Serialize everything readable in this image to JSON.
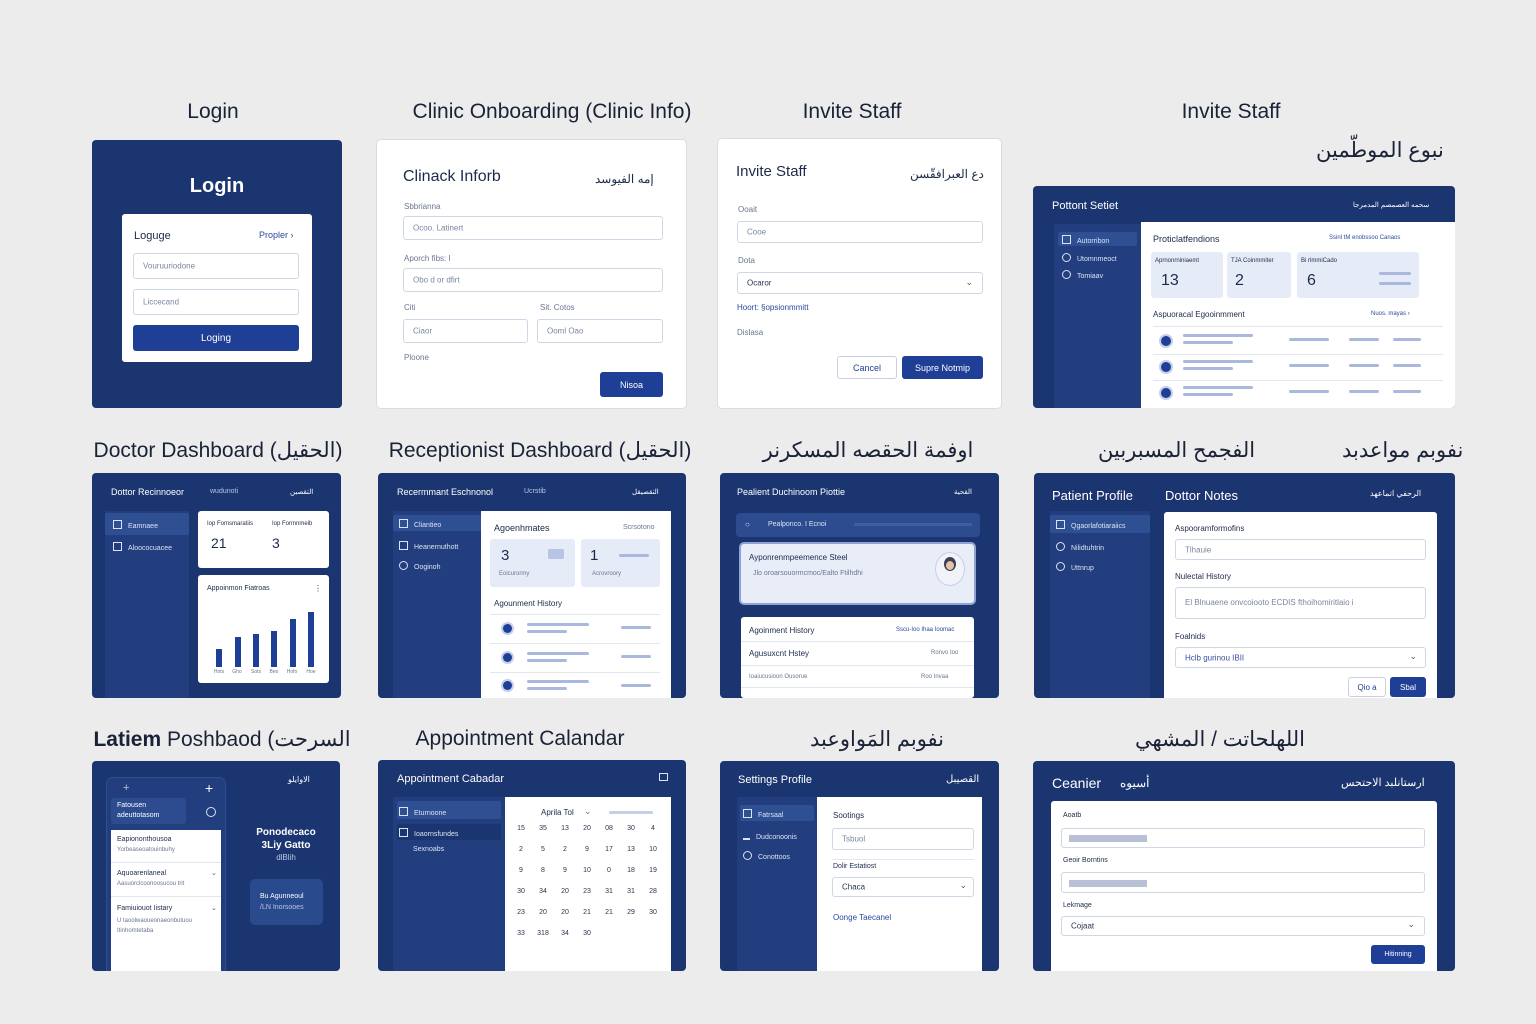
{
  "titles": {
    "login": "Login",
    "clinic": "Clinic Onboarding (Clinic Info)",
    "invite1": "Invite Staff",
    "invite2": "Invite Staff",
    "invite2_ar": "نبوع الموطّمين",
    "doctor": "Doctor Dashboard (الحقيل)",
    "reception": "Receptionist Dashboard (الحقيل)",
    "ar_mid": "اوفمة الحقصه المسكرنر",
    "ar_right1": "الفجمح المسبربين",
    "ar_right2": "نفوبم مواعدبد",
    "latiem_bold": "Latiem",
    "latiem_rest": " Poshbaod (السرحت",
    "calendar": "Appointment Calandar",
    "ar_settings": "نفوبم المَواوعبد",
    "ar_last": "اللهلحاتت / المشهي"
  },
  "login": {
    "heading": "Login",
    "form_title": "Loguge",
    "link": "Propler",
    "field1": "Vouruuriodone",
    "field2": "Liccecand",
    "button": "Loging"
  },
  "clinic": {
    "title": "Clinack Inforb",
    "title_ar": "إمه الفيوسد",
    "label1": "Sbbrianna",
    "ph1": "Ocoo. Latinert",
    "label2": "Aporch fibs: I",
    "ph2": "Obo d or dfirt",
    "label3": "Citi",
    "label4": "Sit. Cotos",
    "ph3": "Ciaor",
    "ph4": "Ooml Oao",
    "label5": "Ploone",
    "button": "Nisoa"
  },
  "invite1": {
    "title": "Invite Staff",
    "title_ar": "دع العبرافقّسن",
    "label1": "Ooait",
    "ph1": "Cooe",
    "label2": "Dota",
    "select": "Ocaror",
    "hint": "Hoort: §opsionmmitt",
    "hint2": "Dislasa",
    "cancel": "Cancel",
    "submit": "Supre Notmip"
  },
  "invite2": {
    "app": "Pottont Setiet",
    "top_ar": "سحمه العصمصم المدمرجا",
    "side": [
      "Autorribon",
      "Utomnmeoct",
      "Tomiaav"
    ],
    "section": "Proticlatfendions",
    "section_link": "Ssinl tM enobssoo Canaos",
    "stats": [
      {
        "label": "Aprnonrniniaemt",
        "value": "13"
      },
      {
        "label": "TJA Coinmmiter",
        "value": "2"
      },
      {
        "label": "Bi rlmmiCado",
        "value": "6"
      }
    ],
    "list_title": "Aspuoracal Egooinmment",
    "list_link": "Nuos. mayas"
  },
  "doctor": {
    "app": "Dottor Recinnoeor",
    "app2": "wudunoti",
    "app_ar": "التقصبن",
    "side": [
      "Eamnaee",
      "Aloococuacee"
    ],
    "stat1_label": "Iop Fomsmaratiis",
    "stat1": "21",
    "stat2_label": "Iop Formnmeib",
    "stat2": "3",
    "chart_title": "Appoinmon Fiatroas",
    "chart_more": "⋮"
  },
  "chart_data": {
    "type": "bar",
    "values": [
      3,
      5,
      5.5,
      6,
      8,
      9.2
    ],
    "categories": [
      "Hots",
      "Gho",
      "Sots",
      "Beo",
      "Hofo",
      "Hoe"
    ],
    "ylim": [
      0,
      10
    ]
  },
  "reception": {
    "app": "Recermmant Eschnonol",
    "app2": "Ucrstib",
    "app_ar": "التقصيقل",
    "side": [
      "Cliantieo",
      "Heanernuthott",
      "Ooginoh"
    ],
    "section": "Agoenhmates",
    "section_link": "Scrsotono",
    "stat1": "3",
    "stat1_label": "Eoicurormy",
    "stat2": "1",
    "stat2_label": "Acrovroory",
    "history": "Agounment History"
  },
  "patient_detail": {
    "app": "Pealient Duchinoom Piottie",
    "app_ar": "القحية",
    "search": "Pealponco. I Ecnoi",
    "card_title": "Ayponrenmpeemence Steel",
    "card_text": "Jlo oroarsouormcmoc/Ealto Ftilhdhi",
    "hist_title": "Agoinment History",
    "hist_link": "Sscu-Ioo Ihaa Ioomac",
    "row1": "Agusuxcnt Hstey",
    "row1r": "Ronvo Ioo",
    "row2": "Ioaiucusioon Ousorue",
    "row2r": "Roo Invaa"
  },
  "notes": {
    "side_title": "Patient Profile",
    "main_title": "Dottor Notes",
    "main_ar": "الرحفي اتماعهد",
    "side": [
      "Qgaorlafotiaraiics",
      "Nilidtuhtrin",
      "Uttnrup"
    ],
    "label1": "Aspooramformofins",
    "ph1": "Tlhauie",
    "label2": "Nulectal History",
    "ph2": "El Blnuaene onvcoiooto ECDIS fthoihomiritlaio i",
    "label3": "Foalnids",
    "select": "Hclb gurinou IBII",
    "cancel": "Qio a",
    "save": "Sbal"
  },
  "latiem": {
    "app_ar": "الاوايلو",
    "tile1": "Fatousen",
    "tile1b": "adeuttotasom",
    "item1": "Eapiononthousoa",
    "item1s": "Yorbeaseoatouinbuhy",
    "item2": "Aquoarenlaneal",
    "item2s": "Aasuorclcoonoosucou trit",
    "item3": "Famiuiouot Iistary",
    "item3s": "U taoolwaoueonaeonbutuou",
    "item3t": "Itinhomtetaba",
    "promo1": "Ponodecaco",
    "promo2": "3Liy Gatto",
    "promo3": "dlBlih",
    "mini1": "Bu Agunneoul",
    "mini2": "/LN Inorsooes"
  },
  "calendar": {
    "app": "Appointment Cabadar",
    "side": [
      "Eturnoone",
      "Ioaornsfundes",
      "Sexnoabs"
    ],
    "month": "Aprila Tol",
    "rows": [
      [
        "15",
        "35",
        "13",
        "20",
        "08",
        "30",
        "4"
      ],
      [
        "2",
        "5",
        "2",
        "9",
        "17",
        "13",
        "10"
      ],
      [
        "9",
        "8",
        "9",
        "10",
        "0",
        "18",
        "19"
      ],
      [
        "30",
        "34",
        "20",
        "23",
        "31",
        "31",
        "28"
      ],
      [
        "23",
        "20",
        "20",
        "21",
        "21",
        "29",
        "30"
      ],
      [
        "33",
        "318",
        "34",
        "30",
        "",
        "",
        ""
      ]
    ]
  },
  "settings": {
    "app": "Settings Profile",
    "app_ar": "القصيبل",
    "side": [
      "Fatrsaal",
      "Dudconoonis",
      "Conottoos"
    ],
    "label1": "Sootings",
    "ph1": "Tsbuol",
    "label2": "Dolir Estatiost",
    "select": "Chaca",
    "link": "Oonge Taecanel"
  },
  "last": {
    "app": "Ceanier",
    "app2": "أسيوه",
    "app_ar": "ارستانلبد الاحتحس",
    "label1": "Aoatb",
    "label2": "Geoir Borntins",
    "label3": "Lekmage",
    "select": "Cojaat",
    "button": "Hitinning"
  }
}
